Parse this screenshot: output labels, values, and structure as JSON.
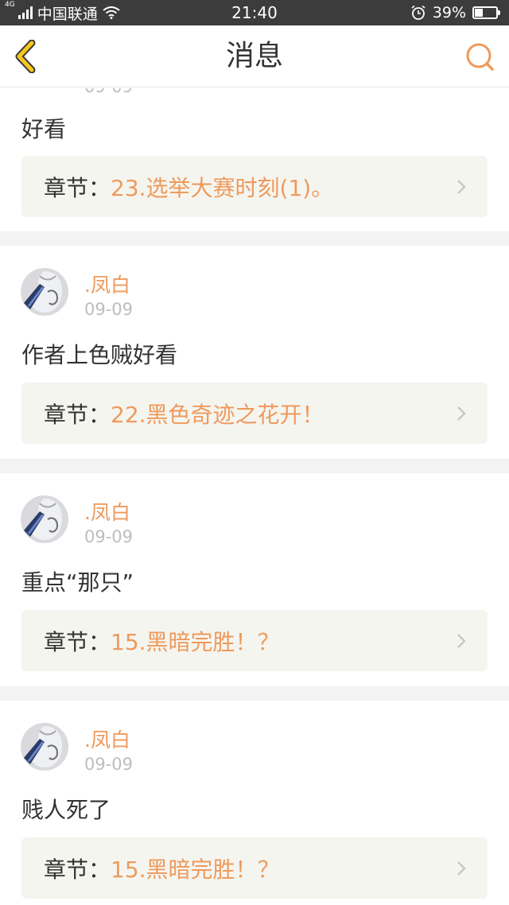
{
  "status_bar": {
    "network_type": "4G",
    "carrier": "中国联通",
    "time": "21:40",
    "battery": "39%",
    "battery_level": 0.39
  },
  "nav": {
    "title": "消息",
    "back_icon": "chevron-left-icon",
    "search_icon": "search-icon",
    "accent_color": "#ee9a5c"
  },
  "items": [
    {
      "username": "",
      "date": "09-09",
      "comment": "好看",
      "chapter_prefix": "章节：",
      "chapter_title": "23.选举大赛时刻(1)。"
    },
    {
      "username": ".凤白",
      "date": "09-09",
      "comment": "作者上色贼好看",
      "chapter_prefix": "章节：",
      "chapter_title": "22.黑色奇迹之花开！"
    },
    {
      "username": ".凤白",
      "date": "09-09",
      "comment": "重点“那只”",
      "chapter_prefix": "章节：",
      "chapter_title": "15.黑暗完胜！？"
    },
    {
      "username": ".凤白",
      "date": "09-09",
      "comment": "贱人死了",
      "chapter_prefix": "章节：",
      "chapter_title": "15.黑暗完胜！？"
    }
  ]
}
